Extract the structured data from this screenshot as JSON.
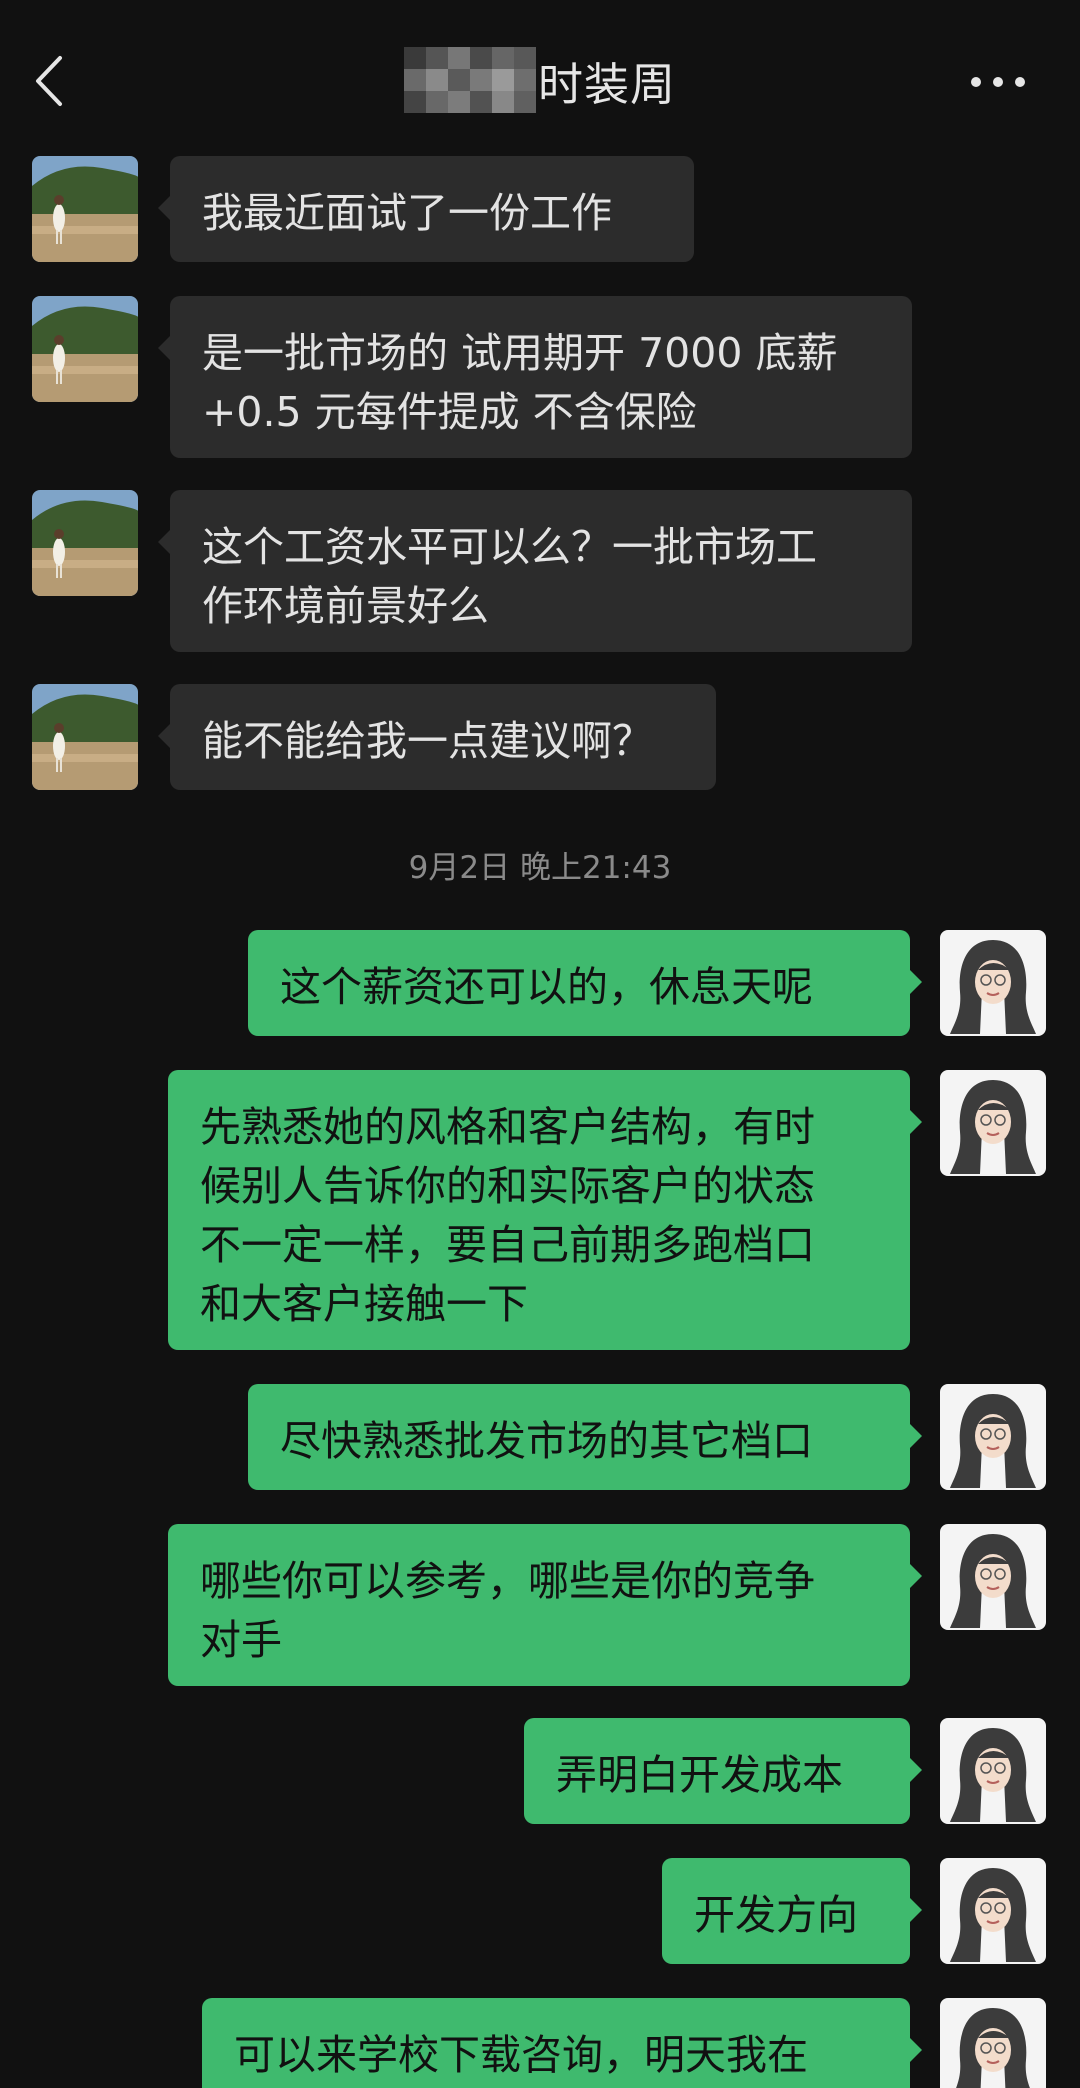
{
  "header": {
    "title": "时装周",
    "back_icon": "chevron-left-icon",
    "more_icon": "more-dots-icon"
  },
  "messages_in": [
    {
      "text": "我最近面试了一份工作"
    },
    {
      "text": "是一批市场的 试用期开 7000 底薪\n+0.5 元每件提成 不含保险"
    },
    {
      "text": "这个工资水平可以么？一批市场工\n作环境前景好么"
    },
    {
      "text": "能不能给我一点建议啊？"
    }
  ],
  "timestamp": "9月2日 晚上21:43",
  "messages_out": [
    {
      "text": "这个薪资还可以的，休息天呢"
    },
    {
      "text": "先熟悉她的风格和客户结构，有时\n候别人告诉你的和实际客户的状态\n不一定一样，要自己前期多跑档口\n和大客户接触一下"
    },
    {
      "text": "尽快熟悉批发市场的其它档口"
    },
    {
      "text": "哪些你可以参考，哪些是你的竞争\n对手"
    },
    {
      "text": "弄明白开发成本"
    },
    {
      "text": "开发方向"
    },
    {
      "text": "可以来学校下载咨询，明天我在"
    }
  ],
  "colors": {
    "background": "#111111",
    "incoming_bubble": "#2c2c2c",
    "outgoing_bubble": "#3fba6e",
    "timestamp_text": "#8a8a8a"
  }
}
